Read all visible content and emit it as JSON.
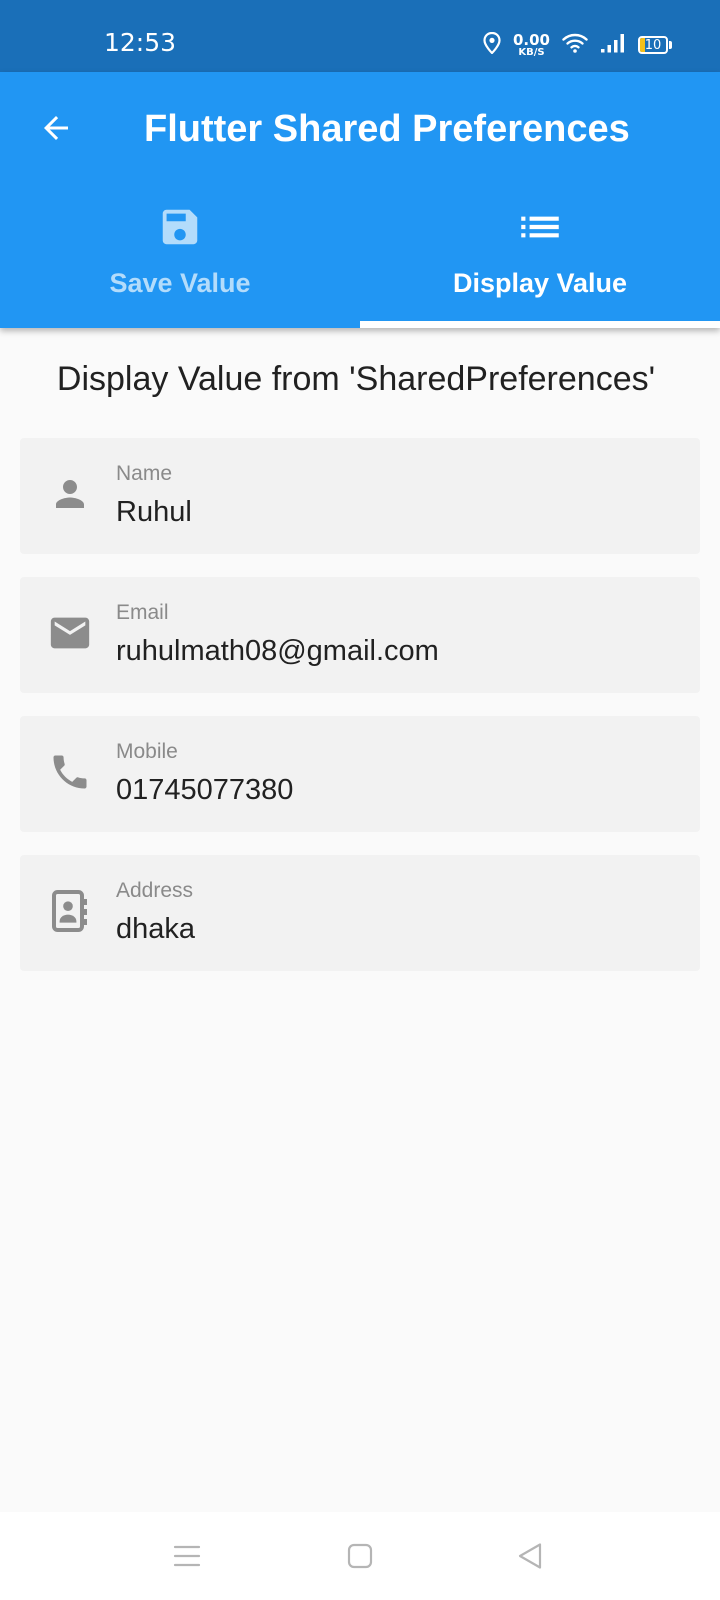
{
  "status_bar": {
    "time": "12:53",
    "net_speed_value": "0.00",
    "net_speed_unit": "KB/S",
    "battery_level": "10",
    "icons": [
      "location-icon",
      "wifi-icon",
      "signal-icon",
      "battery-icon"
    ]
  },
  "app_bar": {
    "title": "Flutter Shared Preferences",
    "back_icon": "arrow-back-icon",
    "background_color": "#2196f3"
  },
  "tabs": [
    {
      "label": "Save Value",
      "icon": "save-icon",
      "selected": false
    },
    {
      "label": "Display Value",
      "icon": "list-icon",
      "selected": true
    }
  ],
  "main": {
    "heading": "Display Value from 'SharedPreferences'",
    "fields": [
      {
        "label": "Name",
        "value": "Ruhul",
        "icon": "person-icon"
      },
      {
        "label": "Email",
        "value": "ruhulmath08@gmail.com",
        "icon": "email-icon"
      },
      {
        "label": "Mobile",
        "value": "01745077380",
        "icon": "phone-icon"
      },
      {
        "label": "Address",
        "value": "dhaka",
        "icon": "contact-book-icon"
      }
    ]
  },
  "nav_bar": {
    "icons": [
      "menu-icon",
      "home-icon",
      "back-triangle-icon"
    ]
  }
}
